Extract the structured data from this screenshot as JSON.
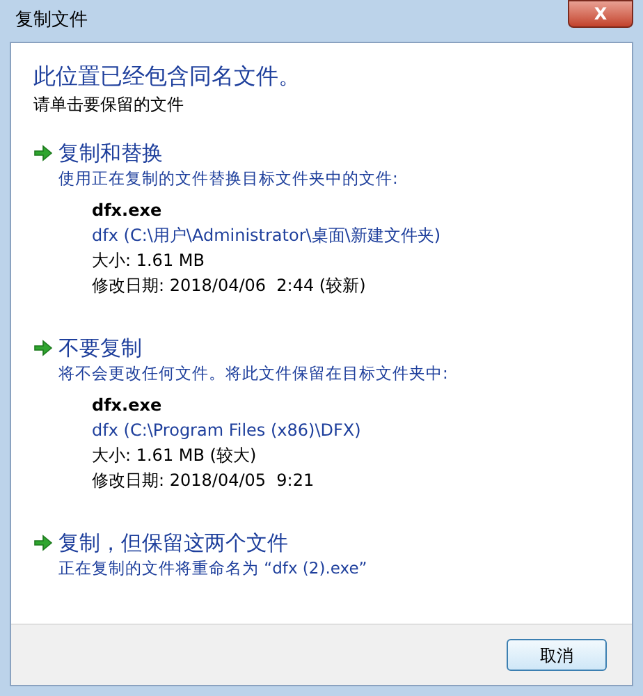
{
  "window": {
    "title": "复制文件",
    "close_label": "X"
  },
  "heading": "此位置已经包含同名文件。",
  "subheading": "请单击要保留的文件",
  "options": [
    {
      "title": "复制和替换",
      "description": "使用正在复制的文件替换目标文件夹中的文件:",
      "file": {
        "name": "dfx.exe",
        "path": "dfx (C:\\用户\\Administrator\\桌面\\新建文件夹)",
        "size": "大小: 1.61 MB",
        "modified": "修改日期: 2018/04/06  2:44 (较新)"
      }
    },
    {
      "title": "不要复制",
      "description": "将不会更改任何文件。将此文件保留在目标文件夹中:",
      "file": {
        "name": "dfx.exe",
        "path": "dfx (C:\\Program Files (x86)\\DFX)",
        "size": "大小: 1.61 MB (较大)",
        "modified": "修改日期: 2018/04/05  9:21"
      }
    },
    {
      "title": "复制，但保留这两个文件",
      "description": "正在复制的文件将重命名为 “dfx (2).exe”"
    }
  ],
  "buttons": [
    "取消"
  ]
}
